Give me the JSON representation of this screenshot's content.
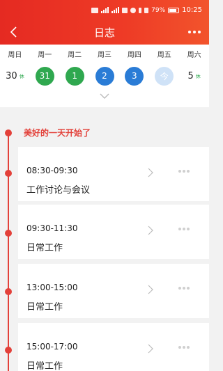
{
  "status_bar": {
    "battery": "79%",
    "time": "10:25"
  },
  "header": {
    "title": "日志"
  },
  "calendar": {
    "weekdays": [
      "周日",
      "周一",
      "周二",
      "周三",
      "周四",
      "周五",
      "周六"
    ],
    "days": [
      {
        "label": "30",
        "tag": "休",
        "style": "plain"
      },
      {
        "label": "31",
        "style": "green"
      },
      {
        "label": "1",
        "style": "green"
      },
      {
        "label": "2",
        "style": "blue"
      },
      {
        "label": "3",
        "style": "blue"
      },
      {
        "label": "今",
        "style": "today"
      },
      {
        "label": "5",
        "tag": "休",
        "style": "plain"
      }
    ]
  },
  "timeline": {
    "start_text": "美好的一天开始了",
    "entries": [
      {
        "time": "08:30-09:30",
        "name": "工作讨论与会议"
      },
      {
        "time": "09:30-11:30",
        "name": "日常工作"
      },
      {
        "time": "13:00-15:00",
        "name": "日常工作"
      },
      {
        "time": "15:00-17:00",
        "name": "日常工作"
      }
    ]
  },
  "colors": {
    "header_red": "#e52a22",
    "timeline_red": "#e3413a",
    "green": "#2fa84f",
    "blue": "#2a7cd6",
    "today": "#cfe2f7"
  }
}
